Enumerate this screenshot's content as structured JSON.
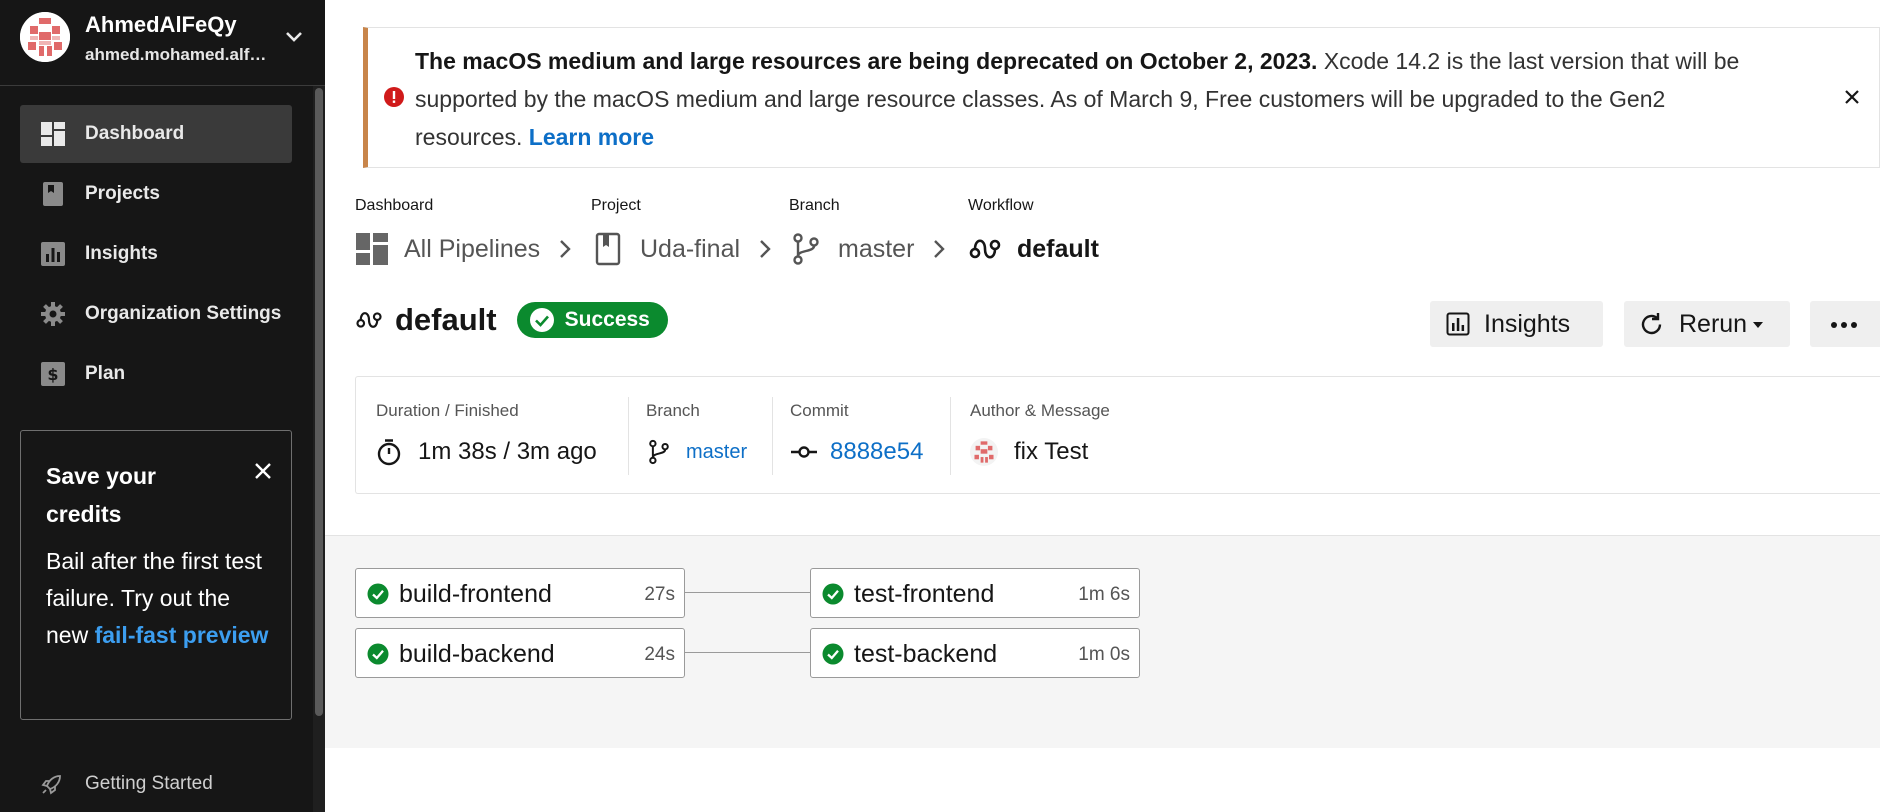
{
  "user": {
    "name": "AhmedAlFeQy",
    "email": "ahmed.mohamed.alfeqy@gmail.com"
  },
  "sidebar": {
    "items": [
      {
        "label": "Dashboard",
        "icon": "dashboard-icon",
        "active": true
      },
      {
        "label": "Projects",
        "icon": "projects-icon",
        "active": false
      },
      {
        "label": "Insights",
        "icon": "insights-icon",
        "active": false
      },
      {
        "label": "Organization Settings",
        "icon": "gear-icon",
        "active": false
      },
      {
        "label": "Plan",
        "icon": "dollar-icon",
        "active": false
      }
    ],
    "promo": {
      "title": "Save your credits",
      "body": "Bail after the first test failure. Try out the new",
      "link": "fail-fast preview"
    },
    "getting_started": "Getting Started"
  },
  "banner": {
    "bold": "The macOS medium and large resources are being deprecated on October 2, 2023.",
    "text": " Xcode 14.2 is the last version that will be supported by the macOS medium and large resource classes. As of March 9, Free customers will be upgraded to the Gen2 resources. ",
    "link": "Learn more"
  },
  "breadcrumb": [
    {
      "label": "Dashboard",
      "value": "All Pipelines",
      "icon": "dashboard-icon"
    },
    {
      "label": "Project",
      "value": "Uda-final",
      "icon": "bookmark-icon"
    },
    {
      "label": "Branch",
      "value": "master",
      "icon": "branch-icon"
    },
    {
      "label": "Workflow",
      "value": "default",
      "icon": "workflow-icon"
    }
  ],
  "workflow": {
    "title": "default",
    "status": "Success",
    "status_color": "#0b8a2e"
  },
  "actions": {
    "insights": "Insights",
    "rerun": "Rerun",
    "more": "more-icon"
  },
  "summary": {
    "duration_label": "Duration / Finished",
    "duration_value": "1m 38s / 3m ago",
    "branch_label": "Branch",
    "branch_value": "master",
    "commit_label": "Commit",
    "commit_value": "8888e54",
    "author_label": "Author & Message",
    "author_message": "fix Test"
  },
  "jobs": [
    {
      "name": "build-frontend",
      "duration": "27s",
      "status": "success"
    },
    {
      "name": "build-backend",
      "duration": "24s",
      "status": "success"
    },
    {
      "name": "test-frontend",
      "duration": "1m 6s",
      "status": "success"
    },
    {
      "name": "test-backend",
      "duration": "1m 0s",
      "status": "success"
    }
  ],
  "colors": {
    "sidebar_bg": "#161616",
    "accent_link": "#0d6fc7",
    "success": "#0b8a2e",
    "warning_border": "#c8854a",
    "error_icon": "#d01a1a"
  }
}
